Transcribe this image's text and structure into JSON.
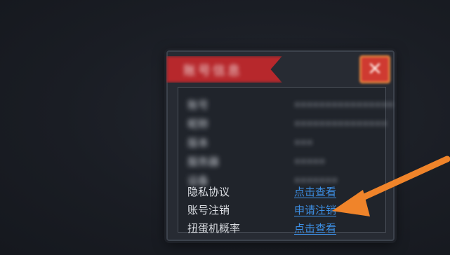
{
  "dialog": {
    "title": "账号信息",
    "close_glyph": "✕",
    "rows": [
      {
        "label": "账号",
        "value": "••••••••••••••••"
      },
      {
        "label": "昵称",
        "value": "•••••••••••••••"
      },
      {
        "label": "版本",
        "value": "•••"
      },
      {
        "label": "服务器",
        "value": "•••••"
      },
      {
        "label": "设备",
        "value": "•••••••"
      },
      {
        "label": "隐私协议",
        "value": "点击查看"
      },
      {
        "label": "账号注销",
        "value": "申请注销"
      },
      {
        "label": "扭蛋机概率",
        "value": "点击查看"
      }
    ]
  },
  "colors": {
    "accent_red": "#b7282c",
    "link_blue": "#3d8fe4",
    "arrow_orange": "#f0842a"
  },
  "icons": {
    "close": "close-icon",
    "pointer": "arrow-pointer-icon"
  }
}
